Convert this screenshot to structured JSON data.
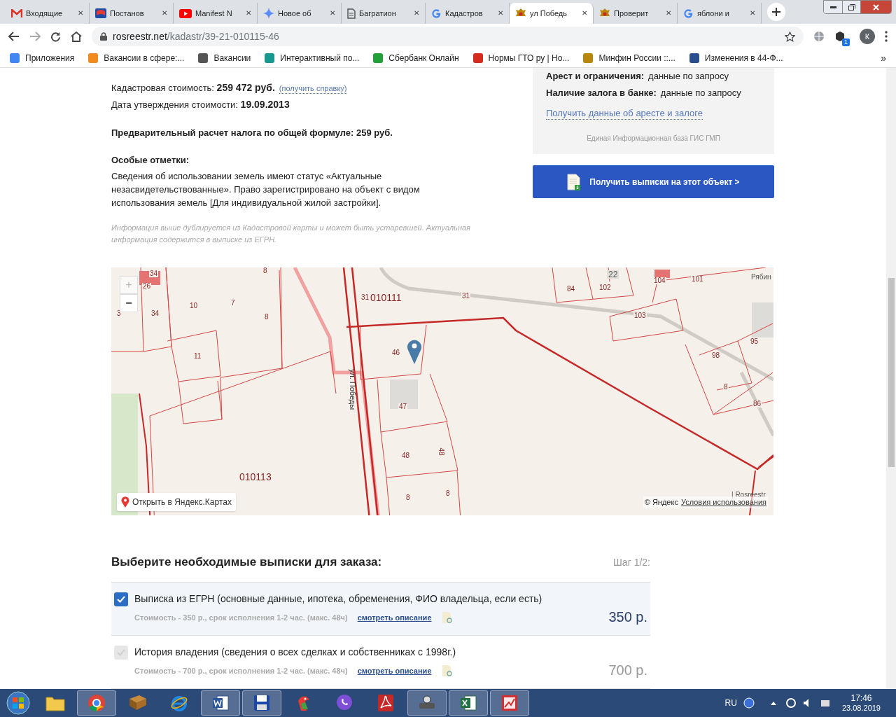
{
  "browser": {
    "tabs": [
      {
        "title": "Входящие",
        "kind": "gmail",
        "selected": false,
        "close": "✕"
      },
      {
        "title": "Постанов",
        "kind": "flag",
        "selected": false,
        "close": "✕"
      },
      {
        "title": "Manifest N",
        "kind": "youtube",
        "selected": false,
        "close": "✕"
      },
      {
        "title": "Новое об",
        "kind": "star",
        "selected": false,
        "close": "✕"
      },
      {
        "title": "Багратион",
        "kind": "doc",
        "selected": false,
        "close": "✕"
      },
      {
        "title": "Кадастров",
        "kind": "google",
        "selected": false,
        "close": "✕"
      },
      {
        "title": "ул Победь",
        "kind": "emblem",
        "selected": true,
        "close": "✕"
      },
      {
        "title": "Проверит",
        "kind": "emblem",
        "selected": false,
        "close": "✕"
      },
      {
        "title": "яблони и",
        "kind": "google",
        "selected": false,
        "close": "✕"
      }
    ],
    "url_domain": "rosreestr.net",
    "url_path": "/kadastr/39-21-010115-46",
    "profile": "К",
    "extension_badge": "1",
    "bookmarks": [
      {
        "label": "Приложения",
        "color": "#4285f4"
      },
      {
        "label": "Вакансии в сфере:...",
        "color": "#f28b1e"
      },
      {
        "label": "Вакансии",
        "color": "#555555"
      },
      {
        "label": "Интерактивный по...",
        "color": "#17998f"
      },
      {
        "label": "Сбербанк Онлайн",
        "color": "#21a038"
      },
      {
        "label": "Нормы ГТО ру | Но...",
        "color": "#d52b1e"
      },
      {
        "label": "Минфин России ::...",
        "color": "#b8860b"
      },
      {
        "label": "Изменения в 44-Ф...",
        "color": "#2a4d8f"
      }
    ],
    "more": "»"
  },
  "page": {
    "info": [
      {
        "kind": "value",
        "label": "Кадастровая стоимость: ",
        "value": "259 472 руб.",
        "link": "(получить справку)"
      },
      {
        "kind": "value",
        "label": "Дата утверждения стоимости: ",
        "value": "19.09.2013"
      },
      {
        "kind": "heading",
        "label": "Предварительный расчет налога по общей формуле: 259 руб."
      },
      {
        "kind": "heading",
        "label": "Особые отметки:"
      },
      {
        "kind": "text",
        "label": "Сведения об использовании земель имеют статус «Актуальные незасвидетельствованные». Право зарегистрировано на объект с видом использования земель [Для индивидуальной жилой застройки]."
      },
      {
        "kind": "note",
        "label": "Информация выше дублируется из Кадастровой карты и может быть устаревшей. Актуальная информация содержится в выписке из ЕГРН."
      }
    ],
    "side": {
      "rows": [
        {
          "label": "Арест и ограничения:",
          "value": "данные по запросу"
        },
        {
          "label": "Наличие залога в банке:",
          "value": "данные по запросу"
        }
      ],
      "link": "Получить данные об аресте и залоге",
      "source": "Единая Информационная база ГИС ГМП",
      "button": "Получить выписки на этот объект >"
    },
    "map": {
      "zoom_in": "+",
      "zoom_out": "−",
      "open": "Открыть в Яндекс.Картах",
      "copyright": "© Яндекс",
      "terms": "Условия использования",
      "labels": [
        {
          "text": "34",
          "kind": "plot"
        },
        {
          "text": "8",
          "kind": "plot"
        },
        {
          "text": "26",
          "kind": "plot"
        },
        {
          "text": "10",
          "kind": "plot"
        },
        {
          "text": "7",
          "kind": "plot"
        },
        {
          "text": "3",
          "kind": "plot"
        },
        {
          "text": "34",
          "kind": "plot"
        },
        {
          "text": "8",
          "kind": "plot"
        },
        {
          "text": "11",
          "kind": "plot"
        },
        {
          "text": "31",
          "kind": "plot"
        },
        {
          "text": "010111",
          "kind": "quarter"
        },
        {
          "text": "31",
          "kind": "street-num"
        },
        {
          "text": "84",
          "kind": "plot"
        },
        {
          "text": "102",
          "kind": "plot"
        },
        {
          "text": "22",
          "kind": "building"
        },
        {
          "text": "104",
          "kind": "plot"
        },
        {
          "text": "101",
          "kind": "plot"
        },
        {
          "text": "Рябин",
          "kind": "street"
        },
        {
          "text": "103",
          "kind": "plot"
        },
        {
          "text": "46",
          "kind": "plot"
        },
        {
          "text": "ул. Победы",
          "kind": "street-vertical"
        },
        {
          "text": "47",
          "kind": "plot"
        },
        {
          "text": "48",
          "kind": "plot"
        },
        {
          "text": "48",
          "kind": "plot-rotated"
        },
        {
          "text": "8",
          "kind": "plot"
        },
        {
          "text": "8",
          "kind": "plot"
        },
        {
          "text": "010113",
          "kind": "quarter"
        },
        {
          "text": "98",
          "kind": "plot"
        },
        {
          "text": "95",
          "kind": "plot"
        },
        {
          "text": "8",
          "kind": "plot"
        },
        {
          "text": "86",
          "kind": "plot"
        },
        {
          "text": "| Rosreestr",
          "kind": "attribution"
        }
      ]
    },
    "order": {
      "title": "Выберите необходимые выписки для заказа:",
      "step": "Шаг 1/2:",
      "items": [
        {
          "title": "Выписка из ЕГРН (основные данные, ипотека, обременения, ФИО владельца, если есть)",
          "detail": "Стоимость - 350 р., срок исполнения 1-2 час. (макс. 48ч)",
          "link": "смотреть описание",
          "price": "350 р.",
          "checked": true,
          "disabled": false
        },
        {
          "title": "История владения (сведения о всех сделках и собственниках с 1998г.)",
          "detail": "Стоимость - 700 р., срок исполнения 1-2 час. (макс. 48ч)",
          "link": "смотреть описание",
          "price": "700 р.",
          "checked": false,
          "disabled": true
        }
      ]
    }
  },
  "taskbar": {
    "apps": [
      {
        "kind": "folder",
        "running": false
      },
      {
        "kind": "chrome",
        "running": true
      },
      {
        "kind": "book",
        "running": false
      },
      {
        "kind": "ie",
        "running": false
      },
      {
        "kind": "word",
        "running": true
      },
      {
        "kind": "floppy",
        "running": true
      },
      {
        "kind": "parrot",
        "running": false
      },
      {
        "kind": "viber",
        "running": false
      },
      {
        "kind": "pdf",
        "running": false
      },
      {
        "kind": "scanner",
        "running": true
      },
      {
        "kind": "excel",
        "running": true
      },
      {
        "kind": "slides",
        "running": true
      }
    ],
    "lang": "RU",
    "time": "17:46",
    "date": "23.08.2019"
  }
}
